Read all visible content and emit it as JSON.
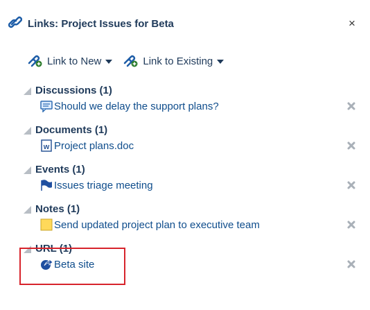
{
  "header": {
    "title": "Links: Project Issues for Beta",
    "close_label": "×"
  },
  "toolbar": {
    "link_to_new": "Link to New",
    "link_to_existing": "Link to Existing"
  },
  "groups": [
    {
      "title": "Discussions (1)",
      "item": "Should we delay the support plans?",
      "icon": "discussion-icon"
    },
    {
      "title": "Documents (1)",
      "item": "Project plans.doc",
      "icon": "word-document-icon"
    },
    {
      "title": "Events (1)",
      "item": "Issues triage meeting",
      "icon": "flag-icon"
    },
    {
      "title": "Notes (1)",
      "item": "Send updated project plan to executive team",
      "icon": "note-icon"
    },
    {
      "title": "URL (1)",
      "item": "Beta site",
      "icon": "url-arrow-icon"
    }
  ],
  "colors": {
    "title": "#1f3a5a",
    "link": "#0f4d8c",
    "highlight_border": "#d7232b",
    "triangle": "#b8bec5"
  }
}
